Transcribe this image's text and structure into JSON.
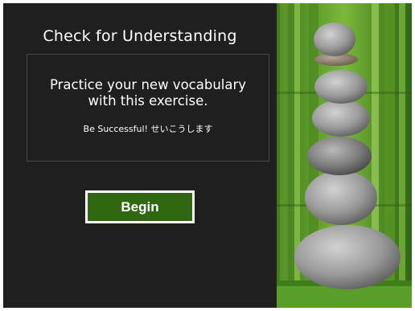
{
  "activity": {
    "title": "Check for Understanding",
    "message": "Practice your new vocabulary\nwith this  exercise.",
    "subtitle": "Be Successful! せいこうします",
    "begin_label": "Begin"
  },
  "image": {
    "subject": "stacked-stones-bamboo"
  },
  "colors": {
    "panel_bg": "#1f1f1f",
    "button_bg": "#2f6810",
    "button_border": "#ffffff",
    "text": "#ffffff"
  }
}
